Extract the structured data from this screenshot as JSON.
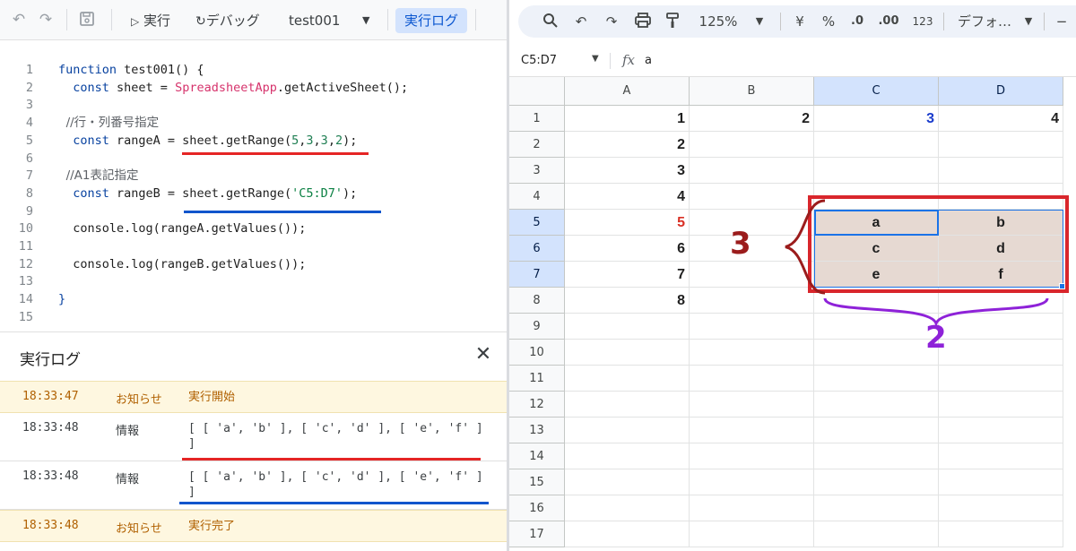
{
  "editor": {
    "toolbar": {
      "run_label": "実行",
      "debug_label": "デバッグ",
      "function_name": "test001",
      "log_label": "実行ログ"
    },
    "code_lines": [
      {
        "n": "1",
        "parts": [
          {
            "t": "function",
            "c": "kw"
          },
          {
            "t": " test001() {",
            "c": ""
          }
        ]
      },
      {
        "n": "2",
        "parts": [
          {
            "t": "  ",
            "c": ""
          },
          {
            "t": "const",
            "c": "kw"
          },
          {
            "t": " sheet = ",
            "c": ""
          },
          {
            "t": "SpreadsheetApp",
            "c": "cls"
          },
          {
            "t": ".getActiveSheet();",
            "c": ""
          }
        ]
      },
      {
        "n": "3",
        "parts": []
      },
      {
        "n": "4",
        "parts": [
          {
            "t": "  //行・列番号指定",
            "c": "cmt"
          }
        ]
      },
      {
        "n": "5",
        "parts": [
          {
            "t": "  ",
            "c": ""
          },
          {
            "t": "const",
            "c": "kw"
          },
          {
            "t": " rangeA = sheet.getRange(",
            "c": ""
          },
          {
            "t": "5",
            "c": "num"
          },
          {
            "t": ",",
            "c": ""
          },
          {
            "t": "3",
            "c": "num"
          },
          {
            "t": ",",
            "c": ""
          },
          {
            "t": "3",
            "c": "num"
          },
          {
            "t": ",",
            "c": ""
          },
          {
            "t": "2",
            "c": "num"
          },
          {
            "t": ");",
            "c": ""
          }
        ]
      },
      {
        "n": "6",
        "parts": []
      },
      {
        "n": "7",
        "parts": [
          {
            "t": "  //A1表記指定",
            "c": "cmt"
          }
        ]
      },
      {
        "n": "8",
        "parts": [
          {
            "t": "  ",
            "c": ""
          },
          {
            "t": "const",
            "c": "kw"
          },
          {
            "t": " rangeB = sheet.getRange(",
            "c": ""
          },
          {
            "t": "'C5:D7'",
            "c": "str"
          },
          {
            "t": ");",
            "c": ""
          }
        ]
      },
      {
        "n": "9",
        "parts": []
      },
      {
        "n": "10",
        "parts": [
          {
            "t": "  console.log(rangeA.getValues());",
            "c": ""
          }
        ]
      },
      {
        "n": "11",
        "parts": []
      },
      {
        "n": "12",
        "parts": [
          {
            "t": "  console.log(rangeB.getValues());",
            "c": ""
          }
        ]
      },
      {
        "n": "13",
        "parts": []
      },
      {
        "n": "14",
        "parts": [
          {
            "t": "}",
            "c": "kw"
          }
        ]
      },
      {
        "n": "15",
        "parts": []
      }
    ],
    "log": {
      "title": "実行ログ",
      "rows": [
        {
          "time": "18:33:47",
          "severity": "お知らせ",
          "message": "実行開始",
          "kind": "notice"
        },
        {
          "time": "18:33:48",
          "severity": "情報",
          "message": "[ [ 'a', 'b' ], [ 'c', 'd' ], [ 'e', 'f' ] ]",
          "kind": "info"
        },
        {
          "time": "18:33:48",
          "severity": "情報",
          "message": "[ [ 'a', 'b' ], [ 'c', 'd' ], [ 'e', 'f' ] ]",
          "kind": "info"
        },
        {
          "time": "18:33:48",
          "severity": "お知らせ",
          "message": "実行完了",
          "kind": "notice"
        }
      ]
    }
  },
  "sheet": {
    "toolbar": {
      "zoom": "125%",
      "currency": "¥",
      "percent": "%",
      "dec_decrease": ".0",
      "dec_increase": ".00",
      "number_format": "123",
      "font": "デフォ…"
    },
    "formula_bar": {
      "name_box": "C5:D7",
      "fx": "fx",
      "value": "a"
    },
    "columns": [
      "A",
      "B",
      "C",
      "D"
    ],
    "rows": [
      "1",
      "2",
      "3",
      "4",
      "5",
      "6",
      "7",
      "8",
      "9",
      "10",
      "11",
      "12",
      "13",
      "14",
      "15",
      "16",
      "17"
    ],
    "cells": [
      {
        "r": 0,
        "c": 0,
        "v": "1"
      },
      {
        "r": 0,
        "c": 1,
        "v": "2"
      },
      {
        "r": 0,
        "c": 2,
        "v": "3",
        "color": "#1a3ccc"
      },
      {
        "r": 0,
        "c": 3,
        "v": "4"
      },
      {
        "r": 1,
        "c": 0,
        "v": "2"
      },
      {
        "r": 2,
        "c": 0,
        "v": "3"
      },
      {
        "r": 3,
        "c": 0,
        "v": "4"
      },
      {
        "r": 4,
        "c": 0,
        "v": "5",
        "color": "#d93025"
      },
      {
        "r": 4,
        "c": 2,
        "v": "a",
        "center": true
      },
      {
        "r": 4,
        "c": 3,
        "v": "b",
        "center": true
      },
      {
        "r": 5,
        "c": 0,
        "v": "6"
      },
      {
        "r": 5,
        "c": 2,
        "v": "c",
        "center": true
      },
      {
        "r": 5,
        "c": 3,
        "v": "d",
        "center": true
      },
      {
        "r": 6,
        "c": 0,
        "v": "7"
      },
      {
        "r": 6,
        "c": 2,
        "v": "e",
        "center": true
      },
      {
        "r": 6,
        "c": 3,
        "v": "f",
        "center": true
      },
      {
        "r": 7,
        "c": 0,
        "v": "8"
      }
    ],
    "annotations": {
      "rows_count": "3",
      "cols_count": "2"
    },
    "colors": {
      "selection": "#1a73e8",
      "highlight_box": "#d9262c",
      "range_fill": "#e6d9d2",
      "brace_rows": "#9b1c1c",
      "brace_cols": "#8e22d8"
    }
  }
}
